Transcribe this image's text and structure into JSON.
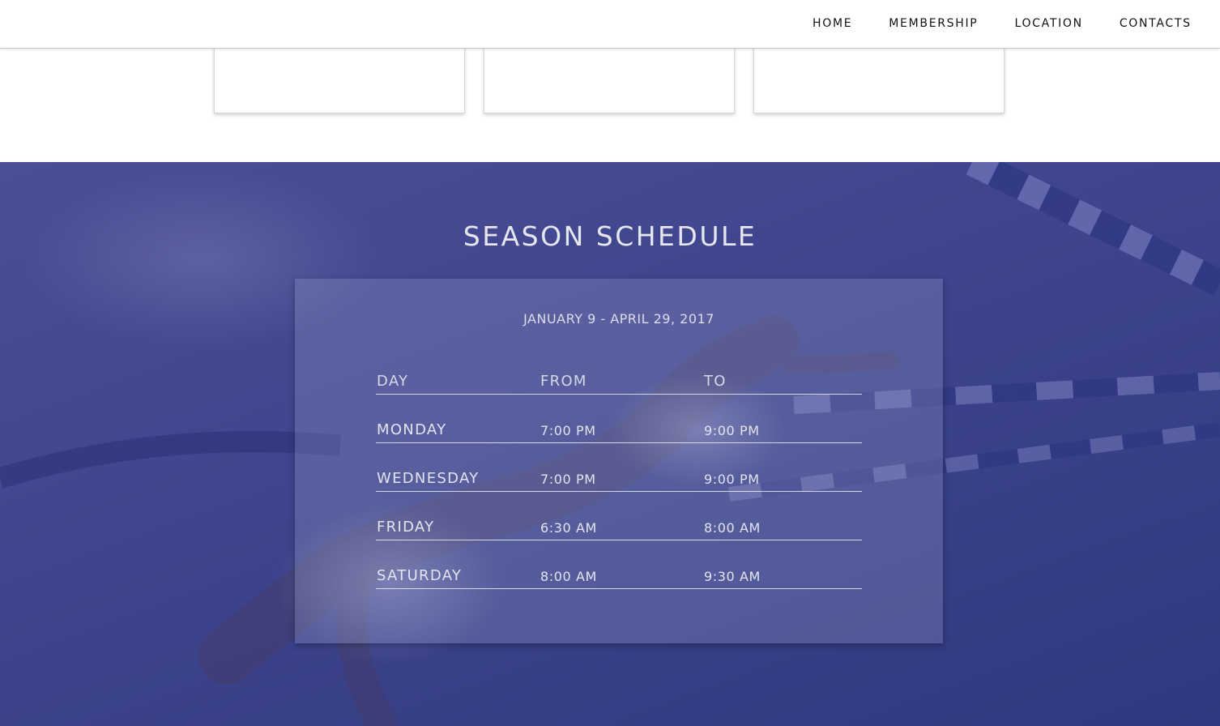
{
  "nav": {
    "items": [
      {
        "label": "HOME"
      },
      {
        "label": "MEMBERSHIP"
      },
      {
        "label": "LOCATION"
      },
      {
        "label": "CONTACTS"
      }
    ]
  },
  "schedule": {
    "title": "SEASON SCHEDULE",
    "dates": "JANUARY 9 - APRIL 29, 2017",
    "headers": {
      "day": "DAY",
      "from": "FROM",
      "to": "TO"
    },
    "rows": [
      {
        "day": "MONDAY",
        "from": "7:00 PM",
        "to": "9:00 PM"
      },
      {
        "day": "WEDNESDAY",
        "from": "7:00 PM",
        "to": "9:00 PM"
      },
      {
        "day": "FRIDAY",
        "from": "6:30 AM",
        "to": "8:00 AM"
      },
      {
        "day": "SATURDAY",
        "from": "8:00 AM",
        "to": "9:30 AM"
      }
    ]
  },
  "colors": {
    "section_bg": "#3f458e",
    "text_light": "#e4e4ef",
    "nav_text": "#111111"
  }
}
